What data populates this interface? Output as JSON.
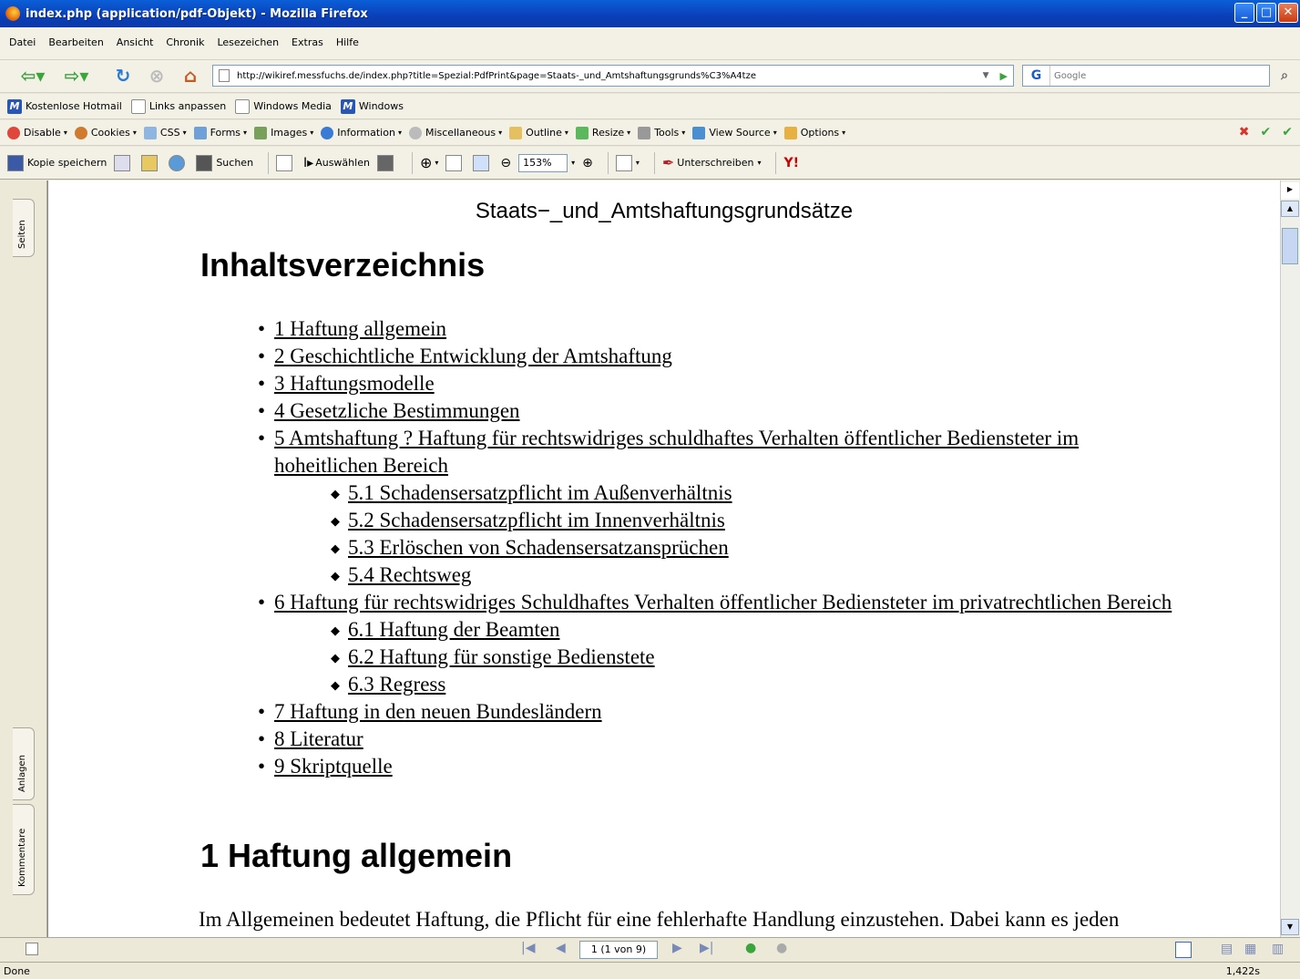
{
  "window": {
    "title": "index.php (application/pdf-Objekt) - Mozilla Firefox"
  },
  "menu": [
    "Datei",
    "Bearbeiten",
    "Ansicht",
    "Chronik",
    "Lesezeichen",
    "Extras",
    "Hilfe"
  ],
  "address": {
    "url": "http://wikiref.messfuchs.de/index.php?title=Spezial:PdfPrint&page=Staats-_und_Amtshaftungsgrunds%C3%A4tze"
  },
  "search": {
    "placeholder": "Google"
  },
  "bookmarks": [
    {
      "label": "Kostenlose Hotmail",
      "icon": "msn-icon"
    },
    {
      "label": "Links anpassen",
      "icon": "page-icon"
    },
    {
      "label": "Windows Media",
      "icon": "page-icon"
    },
    {
      "label": "Windows",
      "icon": "msn-icon"
    }
  ],
  "webdev": [
    "Disable",
    "Cookies",
    "CSS",
    "Forms",
    "Images",
    "Information",
    "Miscellaneous",
    "Outline",
    "Resize",
    "Tools",
    "View Source",
    "Options"
  ],
  "pdf_toolbar": {
    "save": "Kopie speichern",
    "search": "Suchen",
    "select": "Auswählen",
    "zoom": "153%",
    "sign": "Unterschreiben"
  },
  "side_tabs": {
    "pages": "Seiten",
    "attachments": "Anlagen",
    "comments": "Kommentare"
  },
  "document": {
    "header": "Staats−_und_Amtshaftungsgrundsätze",
    "toc_title": "Inhaltsverzeichnis",
    "toc": [
      {
        "text": "1 Haftung allgemein",
        "level": 1
      },
      {
        "text": "2 Geschichtliche Entwicklung der Amtshaftung",
        "level": 1
      },
      {
        "text": "3 Haftungsmodelle",
        "level": 1
      },
      {
        "text": "4 Gesetzliche Bestimmungen",
        "level": 1
      },
      {
        "text": "5 Amtshaftung ? Haftung für rechtswidriges schuldhaftes Verhalten öffentlicher Bediensteter im hoheitlichen Bereich",
        "level": 1
      },
      {
        "text": "5.1 Schadensersatzpflicht im Außenverhältnis",
        "level": 2
      },
      {
        "text": "5.2 Schadensersatzpflicht im Innenverhältnis",
        "level": 2
      },
      {
        "text": "5.3 Erlöschen von Schadensersatzansprüchen",
        "level": 2
      },
      {
        "text": "5.4 Rechtsweg",
        "level": 2
      },
      {
        "text": "6 Haftung für rechtswidriges Schuldhaftes Verhalten öffentlicher Bediensteter im privatrechtlichen Bereich",
        "level": 1
      },
      {
        "text": "6.1 Haftung der Beamten",
        "level": 2
      },
      {
        "text": "6.2 Haftung für sonstige Bedienstete",
        "level": 2
      },
      {
        "text": "6.3 Regress",
        "level": 2
      },
      {
        "text": "7 Haftung in den neuen Bundesländern",
        "level": 1
      },
      {
        "text": "8 Literatur",
        "level": 1
      },
      {
        "text": "9 Skriptquelle",
        "level": 1
      }
    ],
    "section1_title": "1 Haftung allgemein",
    "section1_text": "Im Allgemeinen bedeutet Haftung, die Pflicht für eine fehlerhafte Handlung einzustehen. Dabei kann es jeden"
  },
  "pager": {
    "page": "1 (1 von 9)"
  },
  "status": {
    "text": "Done",
    "time": "1,422s"
  }
}
